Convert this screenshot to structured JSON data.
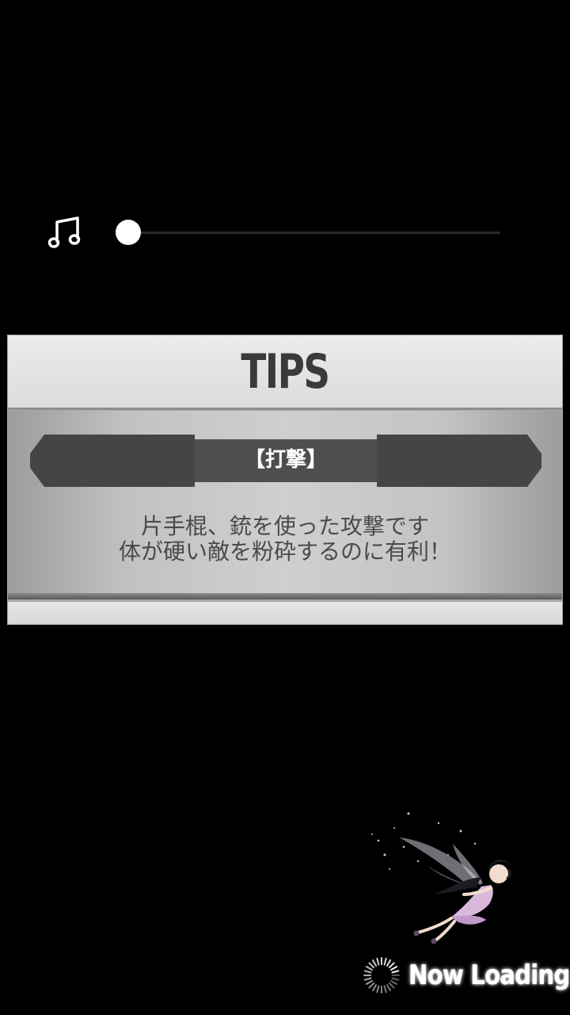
{
  "music": {
    "icon": "music-note-icon",
    "volume_fraction": 0.0
  },
  "tips": {
    "title": "TIPS",
    "category": "【打撃】",
    "lines": [
      "片手棍、銃を使った攻撃です",
      "体が硬い敵を粉砕するのに有利！"
    ]
  },
  "loading": {
    "text": "Now Loading",
    "spinner_icon": "loading-spinner-icon",
    "character_icon": "fairy-character-icon"
  }
}
